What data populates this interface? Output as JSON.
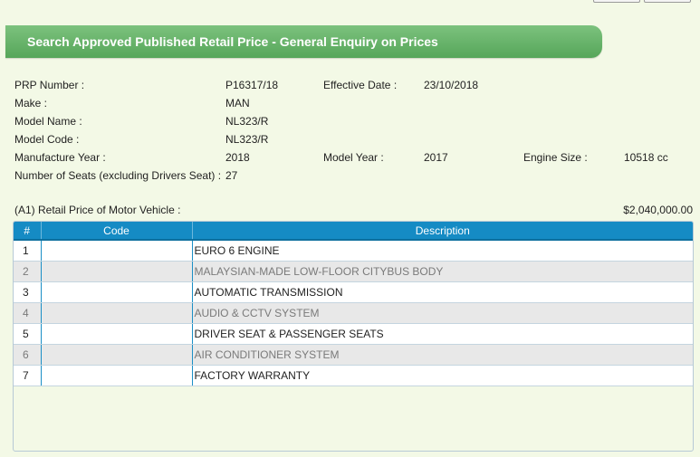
{
  "page": {
    "title": "Search Approved Published Retail Price - General Enquiry on Prices"
  },
  "details": {
    "prp_number_label": "PRP Number :",
    "prp_number": "P16317/18",
    "effective_date_label": "Effective Date :",
    "effective_date": "23/10/2018",
    "make_label": "Make :",
    "make": "MAN",
    "model_name_label": "Model Name :",
    "model_name": "NL323/R",
    "model_code_label": "Model Code :",
    "model_code": "NL323/R",
    "manufacture_year_label": "Manufacture Year :",
    "manufacture_year": "2018",
    "model_year_label": "Model Year :",
    "model_year": "2017",
    "engine_size_label": "Engine Size :",
    "engine_size": "10518 cc",
    "seats_label": "Number of Seats (excluding Drivers Seat) :",
    "seats": "27"
  },
  "retail_price": {
    "label": "(A1) Retail Price of Motor Vehicle :",
    "value": "$2,040,000.00"
  },
  "table": {
    "headers": [
      "#",
      "Code",
      "Description"
    ],
    "rows": [
      {
        "num": "1",
        "code": "",
        "desc": "EURO 6 ENGINE"
      },
      {
        "num": "2",
        "code": "",
        "desc": "MALAYSIAN-MADE LOW-FLOOR CITYBUS BODY"
      },
      {
        "num": "3",
        "code": "",
        "desc": "AUTOMATIC TRANSMISSION"
      },
      {
        "num": "4",
        "code": "",
        "desc": "AUDIO & CCTV SYSTEM"
      },
      {
        "num": "5",
        "code": "",
        "desc": "DRIVER SEAT & PASSENGER SEATS"
      },
      {
        "num": "6",
        "code": "",
        "desc": "AIR CONDITIONER SYSTEM"
      },
      {
        "num": "7",
        "code": "",
        "desc": "FACTORY WARRANTY"
      }
    ]
  },
  "colors": {
    "banner": "#5fae63",
    "header": "#158bc4",
    "background": "#f3f9e6"
  }
}
